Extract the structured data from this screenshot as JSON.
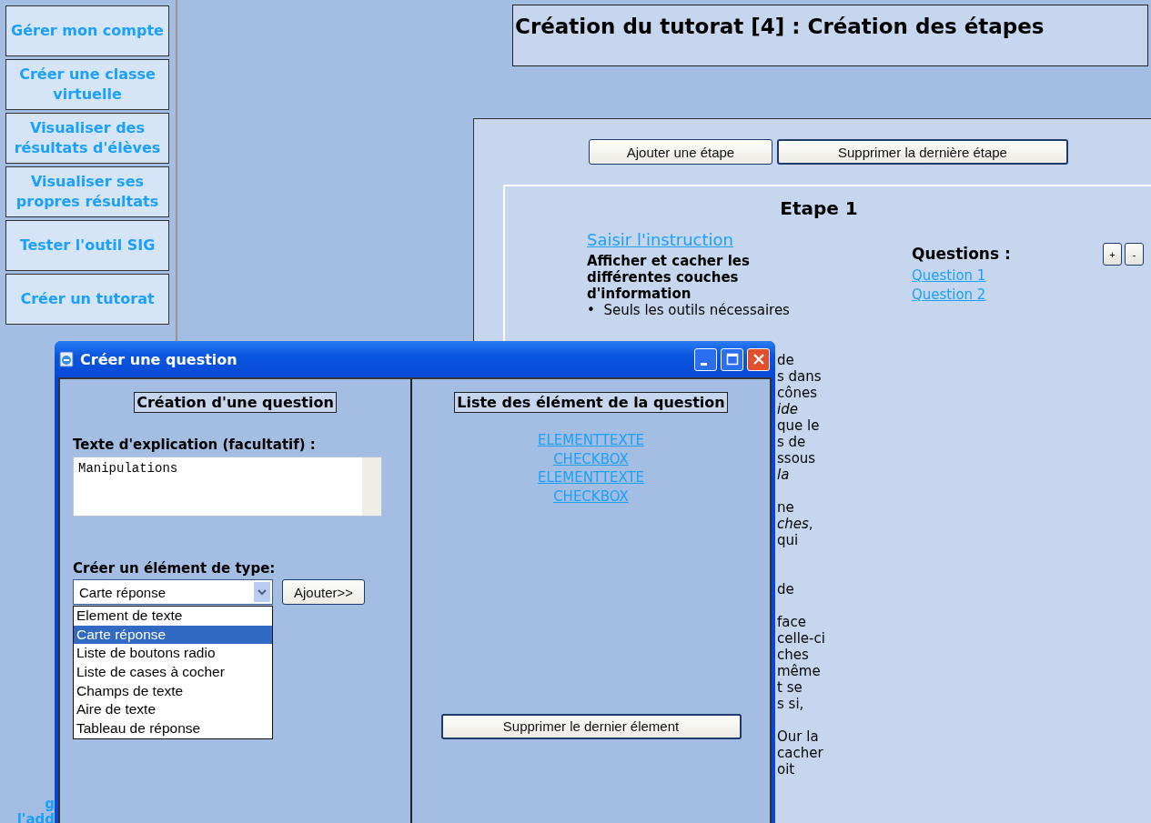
{
  "sidebar": {
    "items": [
      {
        "label": "Gérer mon compte"
      },
      {
        "label": "Créer une classe virtuelle"
      },
      {
        "label": "Visualiser des résultats d'élèves"
      },
      {
        "label": "Visualiser ses propres résultats"
      },
      {
        "label": "Tester l'outil SIG"
      },
      {
        "label": "Créer un tutorat"
      }
    ],
    "footer_fragments": [
      "g",
      "l'add"
    ]
  },
  "page_title": "Création du tutorat [4] : Création des étapes",
  "steps_panel": {
    "buttons": [
      "Ajouter une étape",
      "Supprimer la dernière étape"
    ],
    "step": {
      "title": "Etape 1",
      "instruction_link": "Saisir l'instruction",
      "instruction_title": "Afficher et cacher les différentes couches d'information",
      "bullet": "•  Seuls les outils nécessaires",
      "hidden_line_tails": [
        [
          "de",
          "s dans",
          "cônes",
          "*ide*",
          "que le",
          "s de",
          "ssous",
          "*la*"
        ],
        [
          "ne",
          "*ches*,",
          "qui"
        ],
        [
          "de"
        ],
        [
          "face",
          "celle-ci",
          "ches",
          "même",
          "t se",
          "s si,"
        ],
        [
          "Our la",
          "cacher",
          "oit"
        ]
      ],
      "questions_label": "Questions :",
      "questions": [
        "Question 1",
        "Question 2"
      ],
      "question_controls": [
        "+",
        "-"
      ]
    }
  },
  "dialog": {
    "title": "Créer une question",
    "left": {
      "heading": "Création d'une question",
      "explanation_label": "Texte d'explication (facultatif) :",
      "explanation_value": "Manipulations",
      "type_label": "Créer un élément de type:",
      "type_select": {
        "value": "Carte réponse",
        "expanded": true,
        "options": [
          {
            "label": "Element de texte",
            "selected": false
          },
          {
            "label": "Carte réponse",
            "selected": true
          },
          {
            "label": "Liste de boutons radio",
            "selected": false
          },
          {
            "label": "Liste de cases à cocher",
            "selected": false
          },
          {
            "label": "Champs de texte",
            "selected": false
          },
          {
            "label": "Aire de texte",
            "selected": false
          },
          {
            "label": "Tableau de réponse",
            "selected": false
          }
        ]
      },
      "add_button": "Ajouter>>"
    },
    "right": {
      "heading": "Liste des élément de la question",
      "elements": [
        "ELEMENTTEXTE",
        "CHECKBOX",
        "ELEMENTTEXTE",
        "CHECKBOX"
      ],
      "delete_button": "Supprimer le dernier élement"
    }
  }
}
